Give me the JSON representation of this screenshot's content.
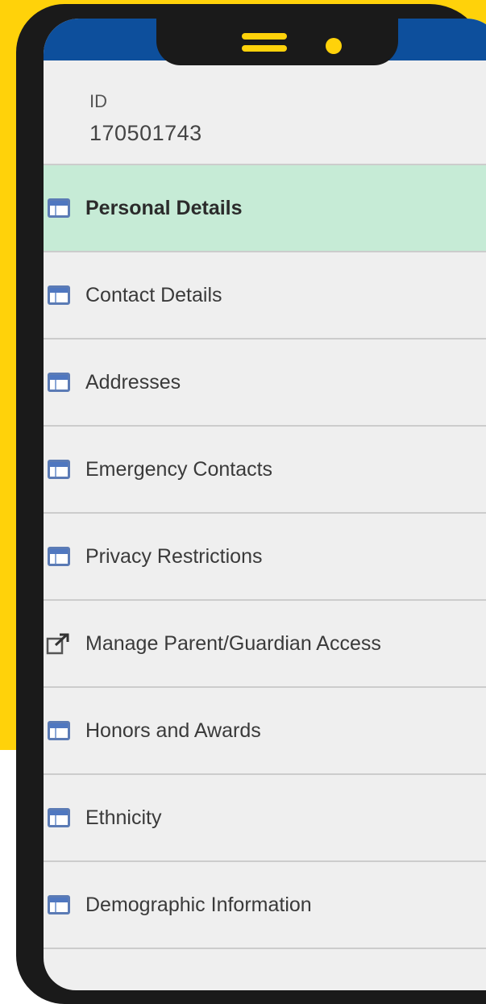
{
  "student": {
    "id_label": "ID",
    "id_value": "170501743"
  },
  "menu": [
    {
      "label": "Personal Details",
      "icon": "page-icon",
      "active": true
    },
    {
      "label": "Contact Details",
      "icon": "page-icon",
      "active": false
    },
    {
      "label": "Addresses",
      "icon": "page-icon",
      "active": false
    },
    {
      "label": "Emergency Contacts",
      "icon": "page-icon",
      "active": false
    },
    {
      "label": "Privacy Restrictions",
      "icon": "page-icon",
      "active": false
    },
    {
      "label": "Manage Parent/Guardian Access",
      "icon": "external-link-icon",
      "active": false
    },
    {
      "label": "Honors and Awards",
      "icon": "page-icon",
      "active": false
    },
    {
      "label": "Ethnicity",
      "icon": "page-icon",
      "active": false
    },
    {
      "label": "Demographic Information",
      "icon": "page-icon",
      "active": false
    }
  ],
  "colors": {
    "background_accent": "#ffd20a",
    "header_bar": "#0d4f9c",
    "active_item": "#c6ebd6",
    "screen_bg": "#efefef"
  }
}
